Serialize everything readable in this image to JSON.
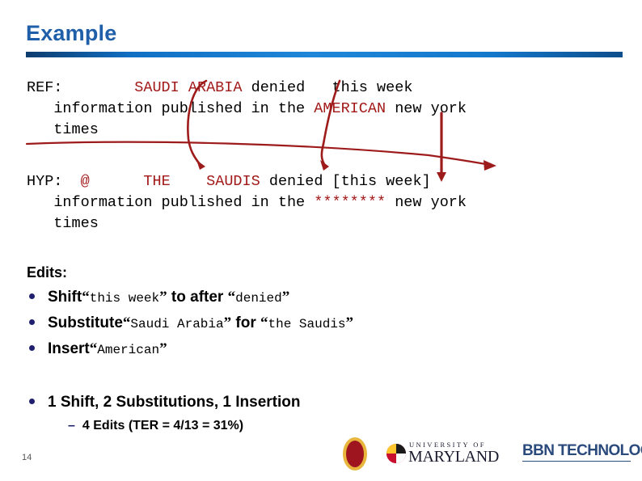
{
  "slide": {
    "title": "Example",
    "page_number": "14",
    "title_color": "#1F5FA9",
    "accent_color": "#A21919",
    "bullet_color": "#1F1F6E"
  },
  "alignment": {
    "ref": {
      "label": "REF:",
      "line1_gap": "        ",
      "highlight1": "SAUDI ARABIA",
      "line1_rest": " denied   this week",
      "line2_indent": "   ",
      "line2_pre": "information published in the ",
      "highlight2": "AMERICAN",
      "line2_post": " new york",
      "line3": "   times"
    },
    "hyp": {
      "label": "HYP:",
      "gap1": "  ",
      "at": "@",
      "gap2": "      ",
      "the": "THE",
      "gap3": "    ",
      "saudis": "SAUDIS",
      "line1_rest": " denied [this week]",
      "line2_indent": "   ",
      "line2_pre": "information published in the ",
      "stars": "********",
      "line2_post": " new york",
      "line3": "   times"
    }
  },
  "edits": {
    "heading": "Edits:",
    "items": [
      {
        "action": "Shift",
        "quote1": "this week",
        "connector": "to after",
        "quote2": "denied"
      },
      {
        "action": "Substitute",
        "quote1": "Saudi Arabia",
        "connector": "for",
        "quote2": "the Saudis"
      },
      {
        "action": "Insert",
        "quote1": "American",
        "connector": "",
        "quote2": ""
      }
    ],
    "open_quote": "“",
    "close_quote": "”"
  },
  "summary": {
    "main": "1 Shift, 2 Substitutions, 1 Insertion",
    "sub_dash": "–",
    "sub": "4 Edits (TER = 4/13 = 31%)"
  },
  "footer": {
    "oval_logo_glyph": " ",
    "umd_top": "UNIVERSITY OF",
    "umd_main": "MARYLAND",
    "bbn": "BBN TECHNOLOGIES"
  }
}
